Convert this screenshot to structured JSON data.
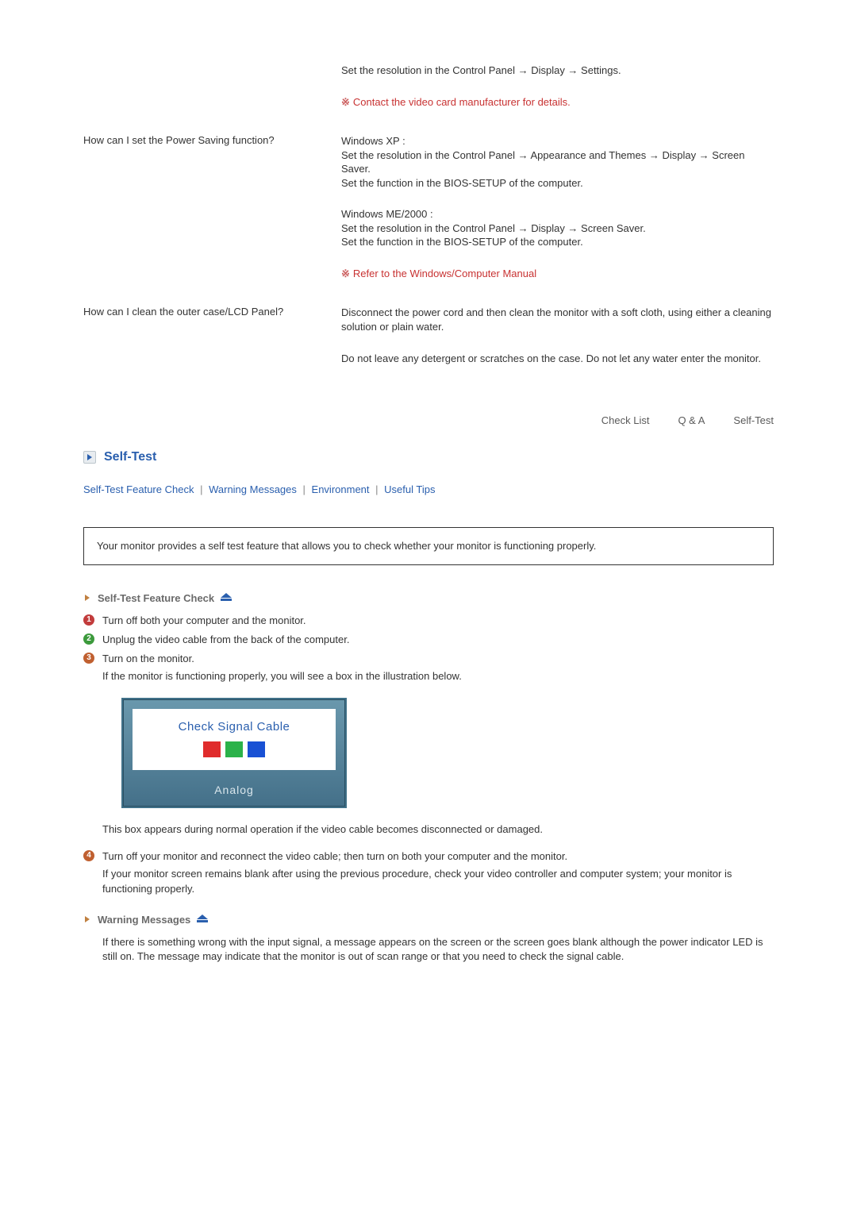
{
  "qa": [
    {
      "question": "",
      "answers": [
        "Set the resolution in the Control Panel → Display → Settings."
      ],
      "note": "Contact the video card manufacturer for details."
    },
    {
      "question": "How can I set the Power Saving function?",
      "answers": [
        "Windows XP :\nSet the resolution in the Control Panel → Appearance and Themes → Display → Screen Saver.\nSet the function in the BIOS-SETUP of the computer.",
        "Windows ME/2000 :\nSet the resolution in the Control Panel → Display → Screen Saver.\nSet the function in the BIOS-SETUP of the computer."
      ],
      "note": "Refer to the Windows/Computer Manual"
    },
    {
      "question": "How can I clean the outer case/LCD Panel?",
      "answers": [
        "Disconnect the power cord and then clean the monitor with a soft cloth, using either a cleaning solution or plain water.",
        "Do not leave any detergent or scratches on the case. Do not let any water enter the monitor."
      ]
    }
  ],
  "tabs": [
    "Check List",
    "Q & A",
    "Self-Test"
  ],
  "section": {
    "title": "Self-Test",
    "subnav": [
      "Self-Test Feature Check",
      "Warning Messages",
      "Environment",
      "Useful Tips"
    ],
    "info_box": "Your monitor provides a self test feature that allows you to check whether your monitor is functioning properly.",
    "feature_check": {
      "title": "Self-Test Feature Check",
      "steps": [
        "Turn off both your computer and the monitor.",
        "Unplug the video cable from the back of the computer.",
        "Turn on the monitor."
      ],
      "step3_extra": "If the monitor is functioning properly, you will see a box in the illustration below.",
      "illustration": {
        "text": "Check Signal Cable",
        "footer": "Analog"
      },
      "after_ill": "This box appears during normal operation if the video cable becomes disconnected or damaged.",
      "step4": "Turn off your monitor and reconnect the video cable; then turn on both your computer and the monitor.",
      "step4_extra": "If your monitor screen remains blank after using the previous procedure, check your video controller and computer system; your monitor is functioning properly."
    },
    "warning": {
      "title": "Warning Messages",
      "body": "If there is something wrong with the input signal, a message appears on the screen or the screen goes blank although the power indicator LED is still on. The message may indicate that the monitor is out of scan range or that you need to check the signal cable."
    }
  }
}
